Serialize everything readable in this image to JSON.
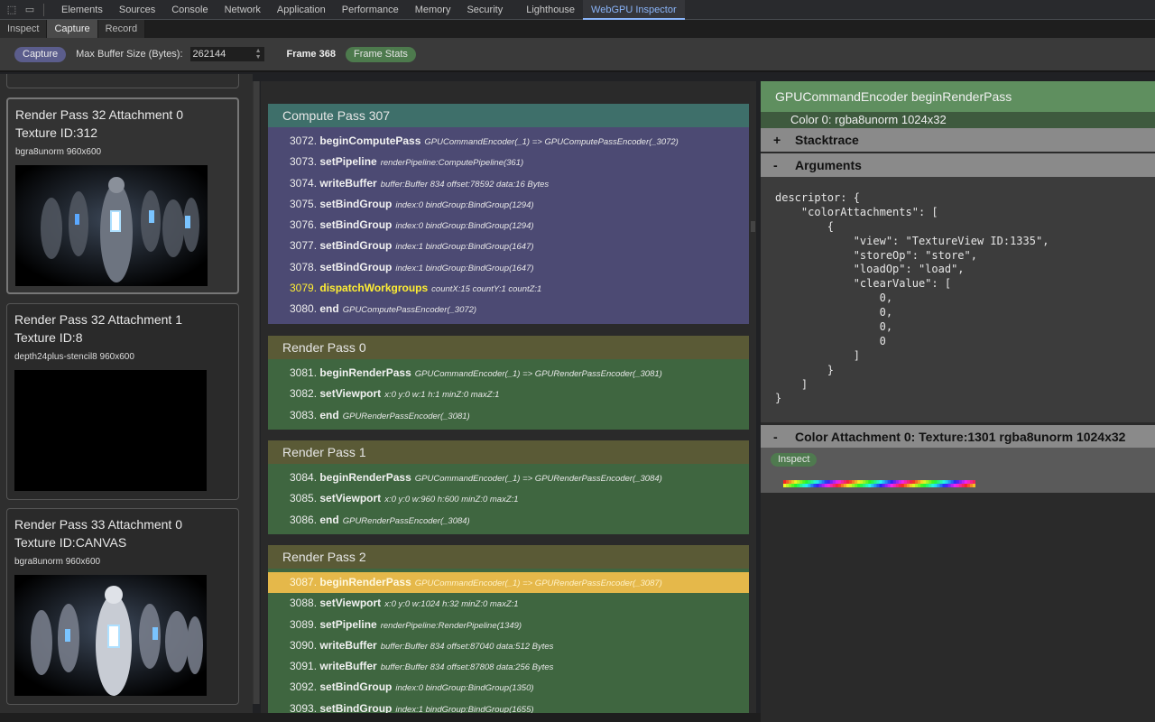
{
  "devtools": {
    "tabs": [
      "Elements",
      "Sources",
      "Console",
      "Network",
      "Application",
      "Performance",
      "Memory",
      "Security",
      "Lighthouse",
      "WebGPU Inspector"
    ],
    "active_tab": "WebGPU Inspector"
  },
  "inspector": {
    "sub_tabs": [
      "Inspect",
      "Capture",
      "Record"
    ],
    "active_sub_tab": "Capture"
  },
  "toolbar": {
    "capture_label": "Capture",
    "max_buffer_label": "Max Buffer Size (Bytes):",
    "max_buffer_value": "262144",
    "frame_label": "Frame 368",
    "frame_stats_label": "Frame Stats"
  },
  "textures": [
    {
      "title": "Render Pass 32 Attachment 0",
      "id": "Texture ID:312",
      "format": "bgra8unorm 960x600",
      "selected": true
    },
    {
      "title": "Render Pass 32 Attachment 1",
      "id": "Texture ID:8",
      "format": "depth24plus-stencil8 960x600",
      "selected": false
    },
    {
      "title": "Render Pass 33 Attachment 0",
      "id": "Texture ID:CANVAS",
      "format": "bgra8unorm 960x600",
      "selected": false
    }
  ],
  "passes": [
    {
      "title": "Compute Pass 307",
      "kind": "compute",
      "commands": [
        {
          "num": "3072.",
          "name": "beginComputePass",
          "args": "GPUCommandEncoder(_1) => GPUComputePassEncoder(_3072)"
        },
        {
          "num": "3073.",
          "name": "setPipeline",
          "args": "renderPipeline:ComputePipeline(361)"
        },
        {
          "num": "3074.",
          "name": "writeBuffer",
          "args": "buffer:Buffer 834 offset:78592 data:16 Bytes"
        },
        {
          "num": "3075.",
          "name": "setBindGroup",
          "args": "index:0 bindGroup:BindGroup(1294)"
        },
        {
          "num": "3076.",
          "name": "setBindGroup",
          "args": "index:0 bindGroup:BindGroup(1294)"
        },
        {
          "num": "3077.",
          "name": "setBindGroup",
          "args": "index:1 bindGroup:BindGroup(1647)"
        },
        {
          "num": "3078.",
          "name": "setBindGroup",
          "args": "index:1 bindGroup:BindGroup(1647)"
        },
        {
          "num": "3079.",
          "name": "dispatchWorkgroups",
          "args": "countX:15 countY:1 countZ:1",
          "highlight": true
        },
        {
          "num": "3080.",
          "name": "end",
          "args": "GPUComputePassEncoder(_3072)"
        }
      ]
    },
    {
      "title": "Render Pass 0",
      "kind": "render",
      "commands": [
        {
          "num": "3081.",
          "name": "beginRenderPass",
          "args": "GPUCommandEncoder(_1) => GPURenderPassEncoder(_3081)"
        },
        {
          "num": "3082.",
          "name": "setViewport",
          "args": "x:0 y:0 w:1 h:1 minZ:0 maxZ:1"
        },
        {
          "num": "3083.",
          "name": "end",
          "args": "GPURenderPassEncoder(_3081)"
        }
      ]
    },
    {
      "title": "Render Pass 1",
      "kind": "render",
      "commands": [
        {
          "num": "3084.",
          "name": "beginRenderPass",
          "args": "GPUCommandEncoder(_1) => GPURenderPassEncoder(_3084)"
        },
        {
          "num": "3085.",
          "name": "setViewport",
          "args": "x:0 y:0 w:960 h:600 minZ:0 maxZ:1"
        },
        {
          "num": "3086.",
          "name": "end",
          "args": "GPURenderPassEncoder(_3084)"
        }
      ]
    },
    {
      "title": "Render Pass 2",
      "kind": "render",
      "commands": [
        {
          "num": "3087.",
          "name": "beginRenderPass",
          "args": "GPUCommandEncoder(_1) => GPURenderPassEncoder(_3087)",
          "selected": true
        },
        {
          "num": "3088.",
          "name": "setViewport",
          "args": "x:0 y:0 w:1024 h:32 minZ:0 maxZ:1"
        },
        {
          "num": "3089.",
          "name": "setPipeline",
          "args": "renderPipeline:RenderPipeline(1349)"
        },
        {
          "num": "3090.",
          "name": "writeBuffer",
          "args": "buffer:Buffer 834 offset:87040 data:512 Bytes"
        },
        {
          "num": "3091.",
          "name": "writeBuffer",
          "args": "buffer:Buffer 834 offset:87808 data:256 Bytes"
        },
        {
          "num": "3092.",
          "name": "setBindGroup",
          "args": "index:0 bindGroup:BindGroup(1350)"
        },
        {
          "num": "3093.",
          "name": "setBindGroup",
          "args": "index:1 bindGroup:BindGroup(1655)"
        }
      ]
    }
  ],
  "details": {
    "title": "GPUCommandEncoder beginRenderPass",
    "subtitle": "Color 0: rgba8unorm 1024x32",
    "stacktrace_label": "Stacktrace",
    "stacktrace_toggle": "+",
    "arguments_label": "Arguments",
    "arguments_toggle": "-",
    "arguments_code": [
      "descriptor: {",
      "    \"colorAttachments\": [",
      "        {",
      "            \"view\": \"TextureView ID:1335\",",
      "            \"storeOp\": \"store\",",
      "            \"loadOp\": \"load\",",
      "            \"clearValue\": [",
      "                0,",
      "                0,",
      "                0,",
      "                0",
      "            ]",
      "        }",
      "    ]",
      "}"
    ],
    "attachment_label": "Color Attachment 0: Texture:1301 rgba8unorm 1024x32",
    "attachment_toggle": "-",
    "inspect_label": "Inspect"
  },
  "colors": {
    "compute_header": "#3e6f6a",
    "compute_body": "#4c4a73",
    "render_header": "#5a5a36",
    "render_body": "#3f6640",
    "selected_row": "#e5b84a",
    "highlight_text": "#ffee33",
    "accent": "#8ab4f8"
  }
}
